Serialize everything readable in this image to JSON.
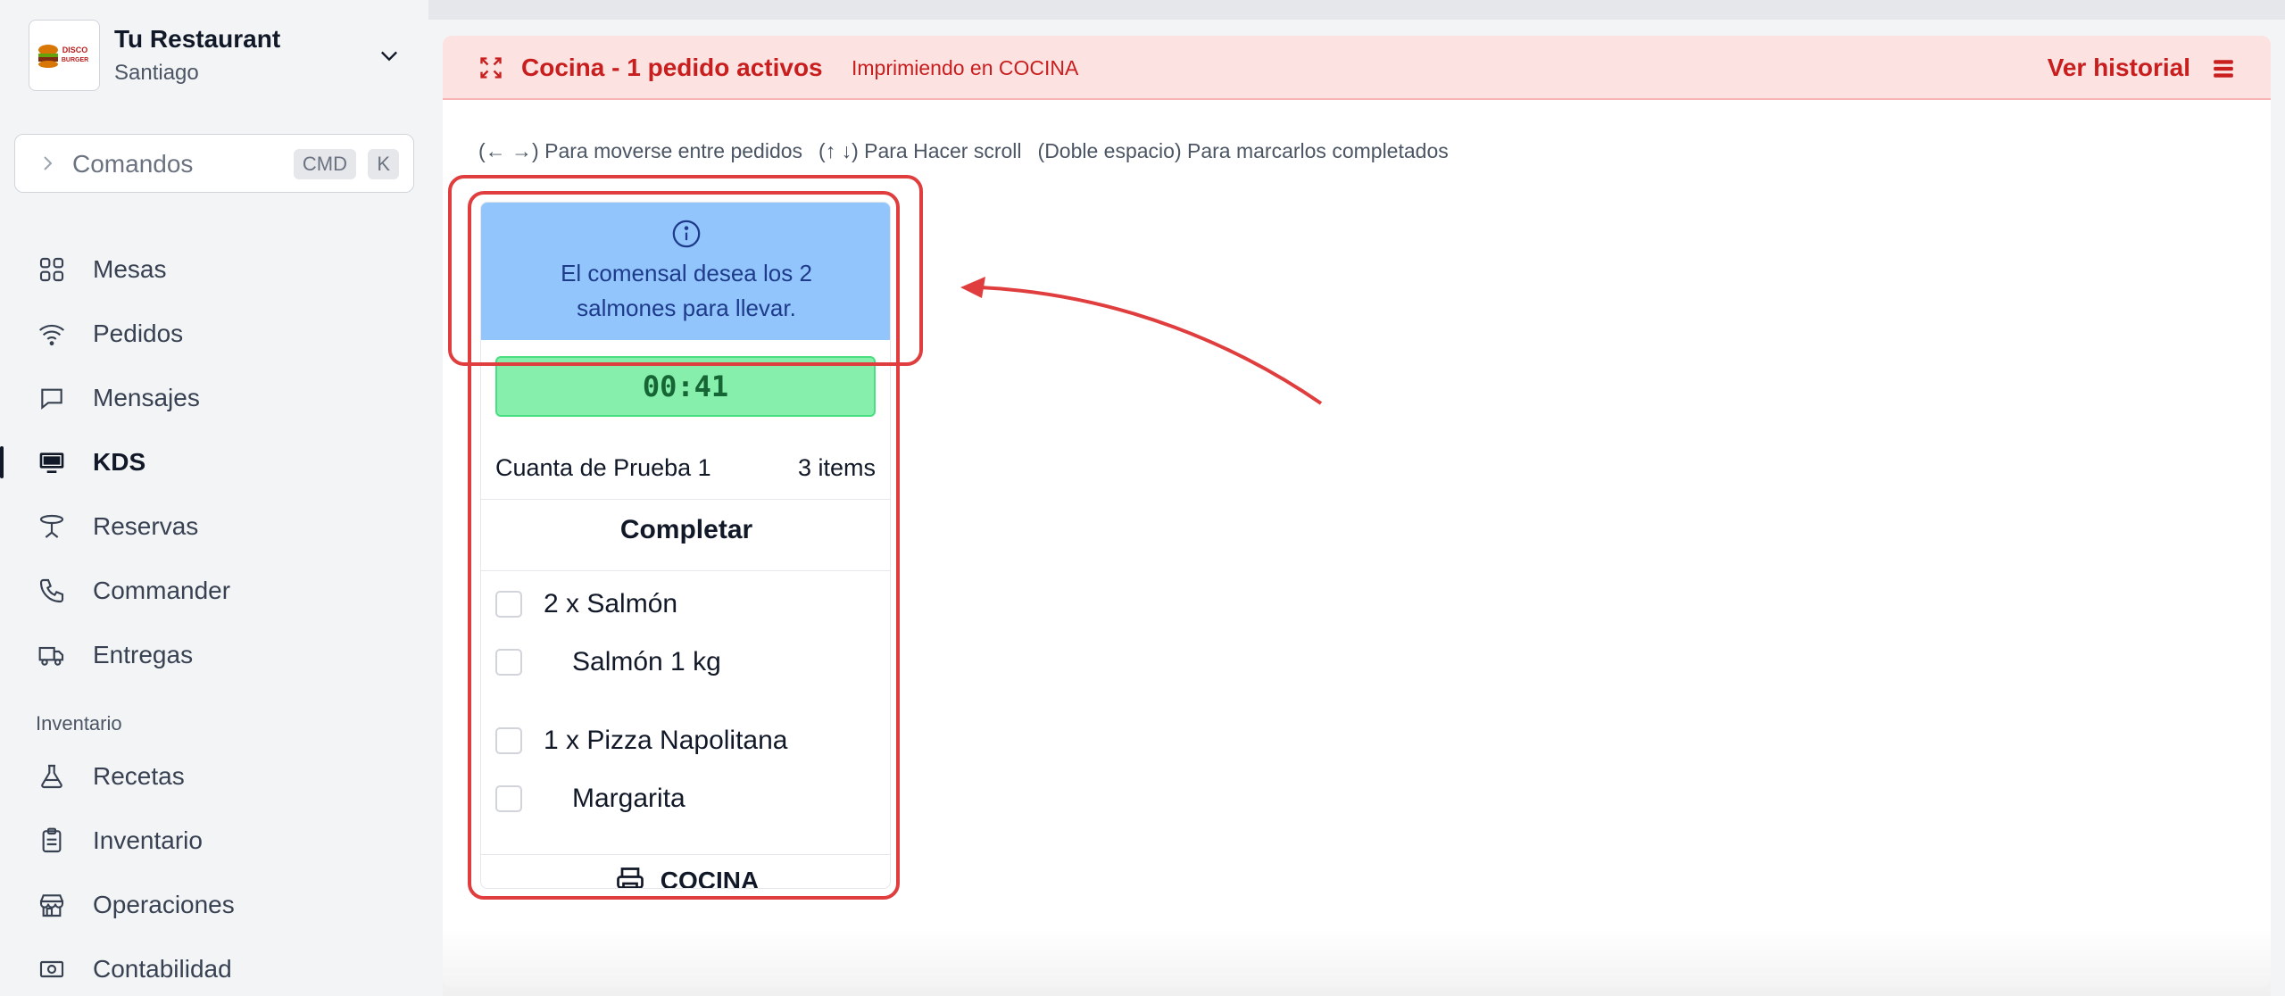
{
  "restaurant": {
    "name": "Tu Restaurant",
    "city": "Santiago",
    "logo_text": "DISCO BURGER"
  },
  "command_box": {
    "label": "Comandos",
    "shortcut_mod": "CMD",
    "shortcut_key": "K"
  },
  "nav": {
    "items": [
      {
        "label": "Mesas",
        "icon": "grid-icon"
      },
      {
        "label": "Pedidos",
        "icon": "wifi-icon"
      },
      {
        "label": "Mensajes",
        "icon": "chat-bubble-icon"
      },
      {
        "label": "KDS",
        "icon": "monitor-icon",
        "active": true
      },
      {
        "label": "Reservas",
        "icon": "table-icon"
      },
      {
        "label": "Commander",
        "icon": "phone-icon"
      },
      {
        "label": "Entregas",
        "icon": "truck-icon"
      }
    ],
    "section_inventory": "Inventario",
    "inventory_items": [
      {
        "label": "Recetas",
        "icon": "flask-icon"
      },
      {
        "label": "Inventario",
        "icon": "clipboard-icon"
      },
      {
        "label": "Operaciones",
        "icon": "store-icon"
      },
      {
        "label": "Contabilidad",
        "icon": "cash-icon"
      }
    ]
  },
  "banner": {
    "title": "Cocina - 1 pedido activos",
    "printing": "Imprimiendo en COCINA",
    "history": "Ver historial",
    "color": "#c81e1e",
    "background": "#fde2e2"
  },
  "hints": [
    "(← →) Para moverse entre pedidos",
    "(↑ ↓) Para Hacer scroll",
    "(Doble espacio) Para marcarlos completados"
  ],
  "order": {
    "note": "El comensal desea los 2 salmones para llevar.",
    "timer": "00:41",
    "account": "Cuanta de Prueba 1",
    "item_count": "3 items",
    "complete_label": "Completar",
    "lines": [
      {
        "text": "2 x Salmón",
        "sub": false
      },
      {
        "text": "Salmón 1 kg",
        "sub": true
      },
      {
        "text": "1 x Pizza Napolitana",
        "sub": false
      },
      {
        "text": "Margarita",
        "sub": true
      }
    ],
    "station": "COCINA",
    "note_color": "#93c5fd",
    "timer_color": "#86efac"
  },
  "annotation_color": "#e03e3e"
}
